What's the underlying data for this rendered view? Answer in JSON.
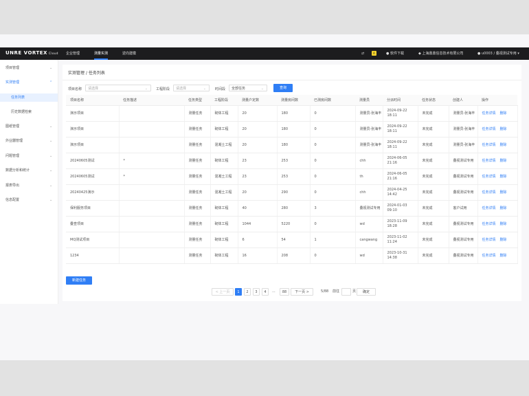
{
  "app": {
    "logo": "UNRE VORTEX",
    "logo_sub": "Cloud"
  },
  "topnav": {
    "items": [
      "企业管理",
      "测量实测",
      "逆向建模"
    ],
    "active": 1
  },
  "toolbar": {
    "badge": "A",
    "download": "软件下载",
    "company": "上海鼎鼎信息技术有限公司",
    "user": "u0003 / 叠视测试专用"
  },
  "sidebar": {
    "items": [
      {
        "label": "项目管理",
        "state": "collapsed"
      },
      {
        "label": "实测管理",
        "state": "open"
      },
      {
        "label": "任务列表",
        "state": "active"
      },
      {
        "label": "历史数据检索",
        "state": "sub"
      },
      {
        "label": "图纸管理",
        "state": "collapsed"
      },
      {
        "label": "外业器管理",
        "state": "collapsed"
      },
      {
        "label": "问题管理",
        "state": "collapsed"
      },
      {
        "label": "数据分析和统计",
        "state": "collapsed"
      },
      {
        "label": "报表导出",
        "state": "collapsed"
      },
      {
        "label": "信息配置",
        "state": "collapsed"
      }
    ]
  },
  "breadcrumb": {
    "parent": "实测管理",
    "sep": "/",
    "current": "任务列表"
  },
  "filters": {
    "project_label": "项目名称",
    "project_placeholder": "请选择",
    "stage_label": "工程阶段",
    "stage_placeholder": "请选择",
    "time_label": "时间段",
    "time_value": "全部任务",
    "search_button": "查询"
  },
  "table": {
    "headers": [
      "项目名称",
      "任务描述",
      "任务类型",
      "工程阶段",
      "测量户定数",
      "测量房间数",
      "已测房间数",
      "测量员",
      "分派时间",
      "任务状态",
      "创建人",
      "操作"
    ],
    "rows": [
      [
        "演示项目",
        "",
        "测量任务",
        "砌体工程",
        "20",
        "180",
        "0",
        "测量员-张海丰",
        "2024-09-22 18:11",
        "未完成",
        "测量员-张海丰",
        "任务详情|删除"
      ],
      [
        "演示项目",
        "",
        "测量任务",
        "砌体工程",
        "20",
        "180",
        "0",
        "测量员-张海丰",
        "2024-09-22 18:11",
        "未完成",
        "测量员-张海丰",
        "任务详情|删除"
      ],
      [
        "演示项目",
        "",
        "测量任务",
        "混凝土工程",
        "20",
        "180",
        "0",
        "测量员-张海丰",
        "2024-09-22 18:11",
        "未完成",
        "测量员-张海丰",
        "任务详情|删除"
      ],
      [
        "20240605测试",
        "*",
        "测量任务",
        "砌体工程",
        "23",
        "253",
        "0",
        "chh",
        "2024-06-05 21:16",
        "未完成",
        "叠视测试专用",
        "任务详情|删除"
      ],
      [
        "20240605测试",
        "*",
        "测量任务",
        "混凝土工程",
        "23",
        "253",
        "0",
        "th",
        "2024-06-05 21:16",
        "未完成",
        "叠视测试专用",
        "任务详情|删除"
      ],
      [
        "20240425演示",
        "",
        "测量任务",
        "混凝土工程",
        "20",
        "290",
        "0",
        "chh",
        "2024-04-25 14:42",
        "未完成",
        "叠视测试专用",
        "任务详情|删除"
      ],
      [
        "保利服务项目",
        "",
        "测量任务",
        "砌体工程",
        "40",
        "280",
        "3",
        "叠视测试专用",
        "2024-01-03 09:10",
        "未完成",
        "客户试用",
        "任务详情|删除"
      ],
      [
        "叠查项目",
        "",
        "测量任务",
        "砌体工程",
        "1044",
        "5220",
        "0",
        "wd",
        "2023-11-09 18:28",
        "未完成",
        "叠视测试专用",
        "任务详情|删除"
      ],
      [
        "MQ测试项目",
        "",
        "测量任务",
        "砌体工程",
        "6",
        "54",
        "1",
        "cangwang",
        "2023-11-02 11:24",
        "未完成",
        "叠视测试专用",
        "任务详情|删除"
      ],
      [
        "1234",
        "",
        "测量任务",
        "砌体工程",
        "16",
        "208",
        "0",
        "wd",
        "2023-10-31 14:38",
        "未完成",
        "叠视测试专用",
        "任务详情|删除"
      ]
    ]
  },
  "new_button": "新建任务",
  "pagination": {
    "prev": "< 上一页",
    "pages": [
      "1",
      "2",
      "3",
      "4",
      "...",
      "88"
    ],
    "current": "1",
    "next": "下一页 >",
    "page_size": "5/88",
    "goto_label": "前往",
    "page_unit": "页",
    "confirm": "确定"
  },
  "colors": {
    "accent": "#2f7ef5",
    "topbar": "#1c1c1e"
  }
}
